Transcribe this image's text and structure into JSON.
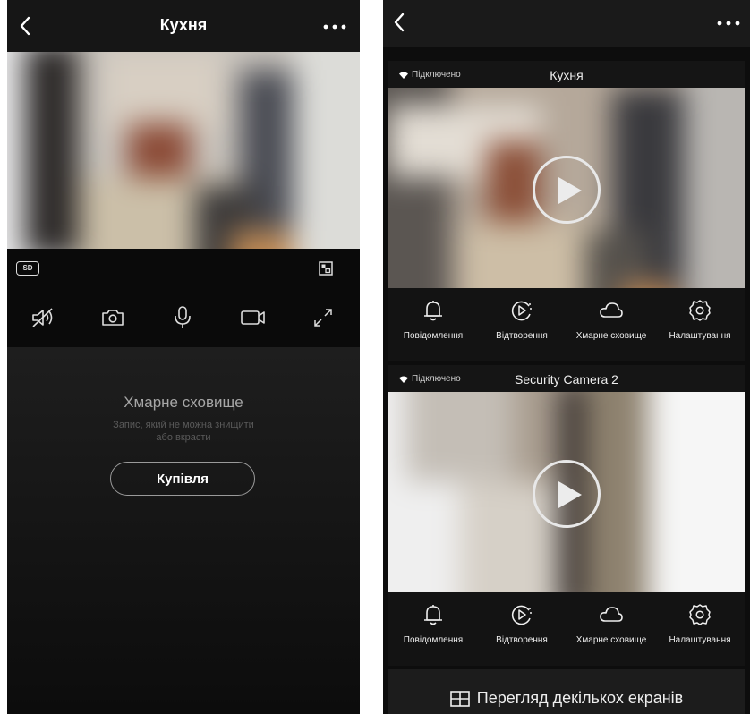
{
  "left_screen": {
    "title": "Кухня",
    "quality_badge": "SD",
    "controls": [
      "mute-icon",
      "snapshot-icon",
      "microphone-icon",
      "record-icon",
      "fullscreen-icon"
    ],
    "cloud": {
      "title": "Хмарне сховище",
      "subtitle_line1": "Запис, який не можна знищити",
      "subtitle_line2": "або вкрасти",
      "button": "Купівля"
    }
  },
  "right_screen": {
    "cameras": [
      {
        "status": "Підключено",
        "name": "Кухня"
      },
      {
        "status": "Підключено",
        "name": "Security Camera 2"
      }
    ],
    "actions": [
      "Повідомлення",
      "Відтворення",
      "Хмарне сховище",
      "Налаштування"
    ],
    "multi_view_label": "Перегляд декількох екранів"
  },
  "colors": {
    "background": "#0f0f0f",
    "text": "#ffffff",
    "muted": "#a6a6a6"
  }
}
